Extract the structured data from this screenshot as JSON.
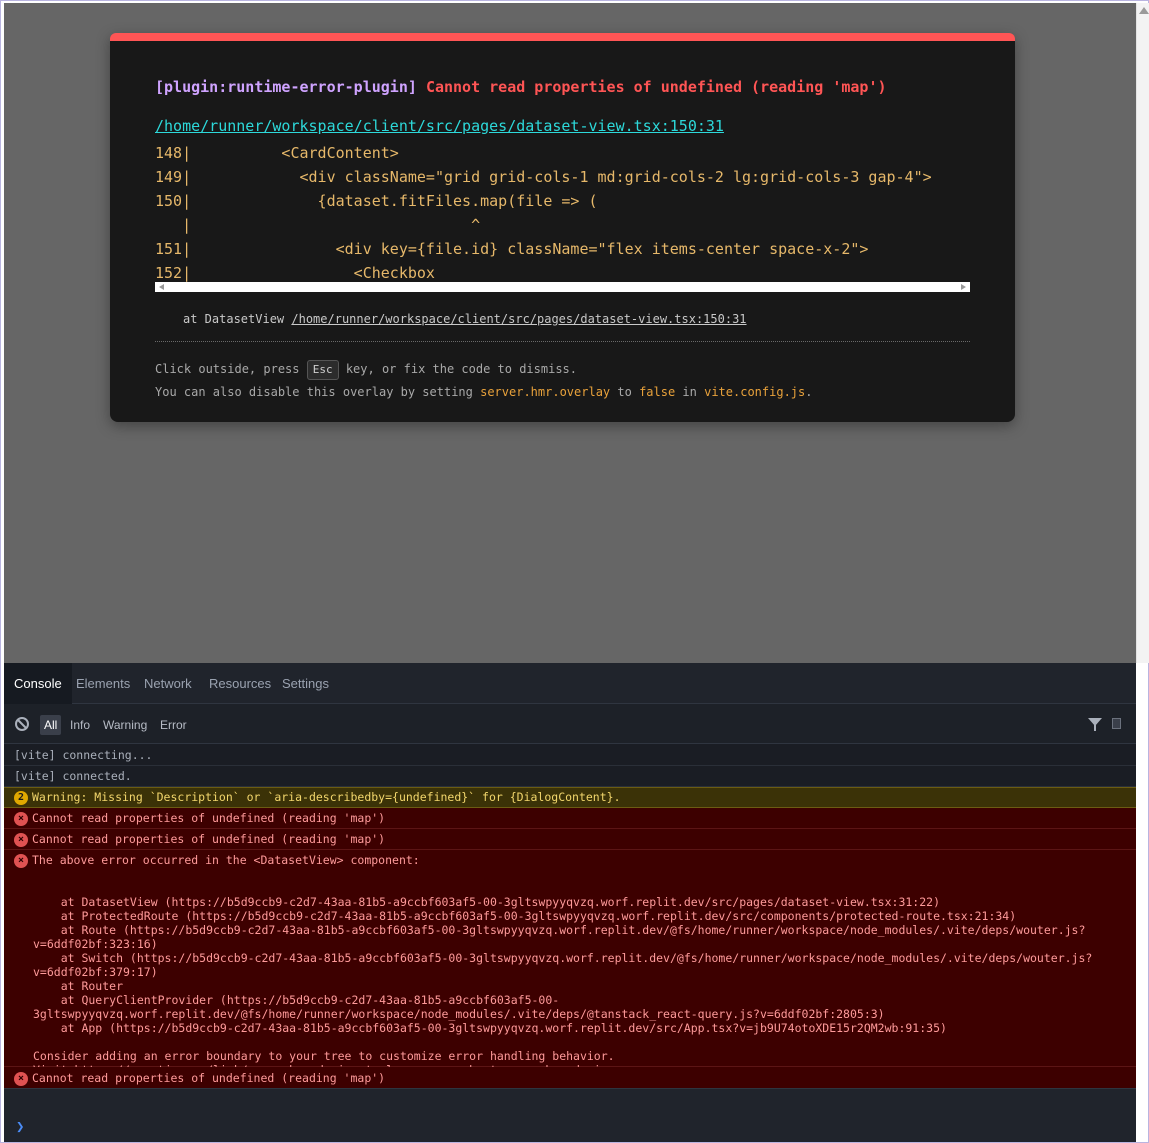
{
  "overlay": {
    "plugin": "[plugin:runtime-error-plugin]",
    "message": "Cannot read properties of undefined (reading 'map')",
    "file_link": "/home/runner/workspace/client/src/pages/dataset-view.tsx:150:31",
    "code_lines": [
      "148|          <CardContent>",
      "149|            <div className=\"grid grid-cols-1 md:grid-cols-2 lg:grid-cols-3 gap-4\">",
      "150|              {dataset.fitFiles.map(file => (",
      "   |                               ^",
      "151|                <div key={file.id} className=\"flex items-center space-x-2\">",
      "152|                  <Checkbox"
    ],
    "stack_prefix": "at DatasetView ",
    "stack_path": "/home/runner/workspace/client/src/pages/dataset-view.tsx:150:31",
    "tip_line1_a": "Click outside, press ",
    "esc_key": "Esc",
    "tip_line1_b": " key, or fix the code to dismiss.",
    "tip_line2_a": "You can also disable this overlay by setting ",
    "tip_setting": "server.hmr.overlay",
    "tip_line2_b": " to ",
    "tip_false": "false",
    "tip_line2_c": " in ",
    "tip_config": "vite.config.js",
    "tip_line2_d": "."
  },
  "devtools": {
    "tabs": [
      "Console",
      "Elements",
      "Network",
      "Resources",
      "Settings"
    ],
    "active_tab": "Console",
    "filters": [
      "All",
      "Info",
      "Warning",
      "Error"
    ],
    "active_filter": "All",
    "logs": {
      "connecting": "[vite] connecting...",
      "connected": "[vite] connected.",
      "warning_count": "2",
      "warning": "Warning: Missing `Description` or `aria-describedby={undefined}` for {DialogContent}.",
      "error1": "Cannot read properties of undefined (reading 'map')",
      "error2": "Cannot read properties of undefined (reading 'map')",
      "error3_head": "The above error occurred in the <DatasetView> component:",
      "error3_detail": "\n    at DatasetView (https://b5d9ccb9-c2d7-43aa-81b5-a9ccbf603af5-00-3gltswpyyqvzq.worf.replit.dev/src/pages/dataset-view.tsx:31:22)\n    at ProtectedRoute (https://b5d9ccb9-c2d7-43aa-81b5-a9ccbf603af5-00-3gltswpyyqvzq.worf.replit.dev/src/components/protected-route.tsx:21:34)\n    at Route (https://b5d9ccb9-c2d7-43aa-81b5-a9ccbf603af5-00-3gltswpyyqvzq.worf.replit.dev/@fs/home/runner/workspace/node_modules/.vite/deps/wouter.js?\nv=6ddf02bf:323:16)\n    at Switch (https://b5d9ccb9-c2d7-43aa-81b5-a9ccbf603af5-00-3gltswpyyqvzq.worf.replit.dev/@fs/home/runner/workspace/node_modules/.vite/deps/wouter.js?\nv=6ddf02bf:379:17)\n    at Router\n    at QueryClientProvider (https://b5d9ccb9-c2d7-43aa-81b5-a9ccbf603af5-00-\n3gltswpyyqvzq.worf.replit.dev/@fs/home/runner/workspace/node_modules/.vite/deps/@tanstack_react-query.js?v=6ddf02bf:2805:3)\n    at App (https://b5d9ccb9-c2d7-43aa-81b5-a9ccbf603af5-00-3gltswpyyqvzq.worf.replit.dev/src/App.tsx?v=jb9U74otoXDE15r2QM2wb:91:35)\n\nConsider adding an error boundary to your tree to customize error handling behavior.\nVisit https://reactjs.org/link/error-boundaries to learn more about error boundaries.",
      "error4": "Cannot read properties of undefined (reading 'map')"
    },
    "prompt_symbol": "❯"
  }
}
